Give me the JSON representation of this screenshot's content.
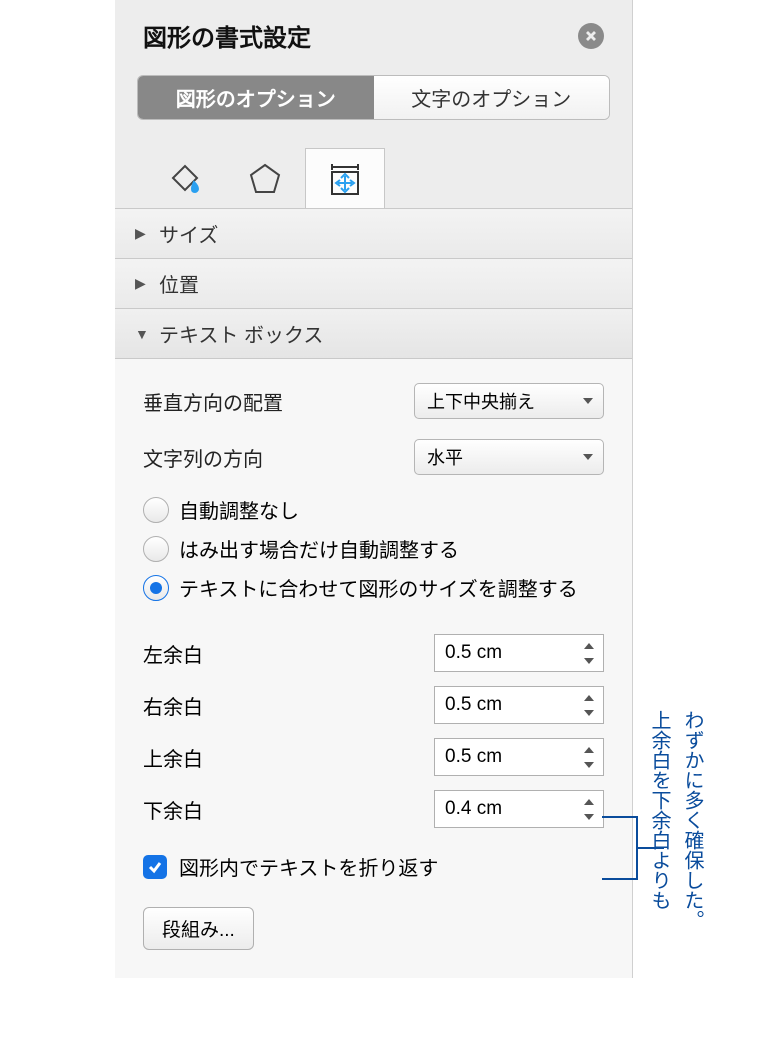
{
  "panel": {
    "title": "図形の書式設定",
    "tabs": [
      "図形のオプション",
      "文字のオプション"
    ],
    "active_tab": 0
  },
  "sections": {
    "size": {
      "label": "サイズ",
      "open": false
    },
    "position": {
      "label": "位置",
      "open": false
    },
    "textbox": {
      "label": "テキスト ボックス",
      "open": true
    }
  },
  "textbox": {
    "vertical_align": {
      "label": "垂直方向の配置",
      "value": "上下中央揃え"
    },
    "text_direction": {
      "label": "文字列の方向",
      "value": "水平"
    },
    "autofit": {
      "options": [
        "自動調整なし",
        "はみ出す場合だけ自動調整する",
        "テキストに合わせて図形のサイズを調整する"
      ],
      "selected": 2
    },
    "margins": {
      "left": {
        "label": "左余白",
        "value": "0.5 cm"
      },
      "right": {
        "label": "右余白",
        "value": "0.5 cm"
      },
      "top": {
        "label": "上余白",
        "value": "0.5 cm"
      },
      "bottom": {
        "label": "下余白",
        "value": "0.4 cm"
      }
    },
    "wrap": {
      "label": "図形内でテキストを折り返す",
      "checked": true
    },
    "columns_button": "段組み..."
  },
  "annotation": {
    "line1": "上余白を下余白よりも",
    "line2": "わずかに多く確保した。"
  }
}
